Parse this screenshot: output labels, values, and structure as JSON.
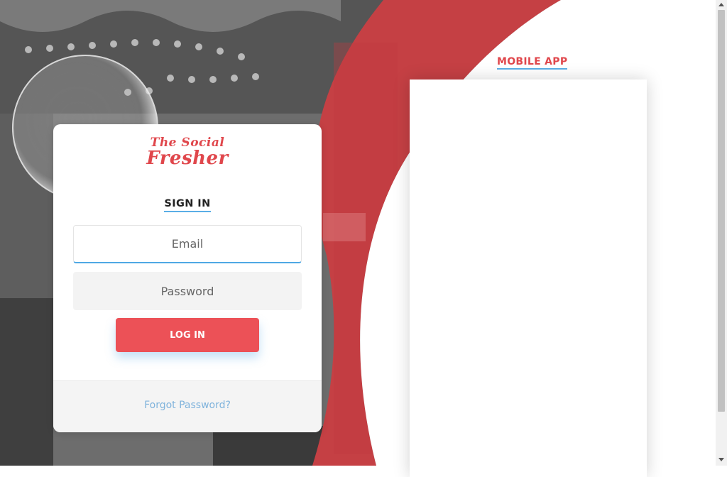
{
  "brand": {
    "line1": "The Social",
    "line2": "Fresher",
    "color": "#e0474c"
  },
  "login": {
    "title": "SIGN IN",
    "email_placeholder": "Email",
    "password_placeholder": "Password",
    "button_label": "LOG IN",
    "forgot_label": "Forgot Password?"
  },
  "mobile_app": {
    "title": "MOBILE APP"
  },
  "colors": {
    "accent": "#ec5157",
    "underline": "#5aaee6",
    "link": "#7fb3dc"
  }
}
